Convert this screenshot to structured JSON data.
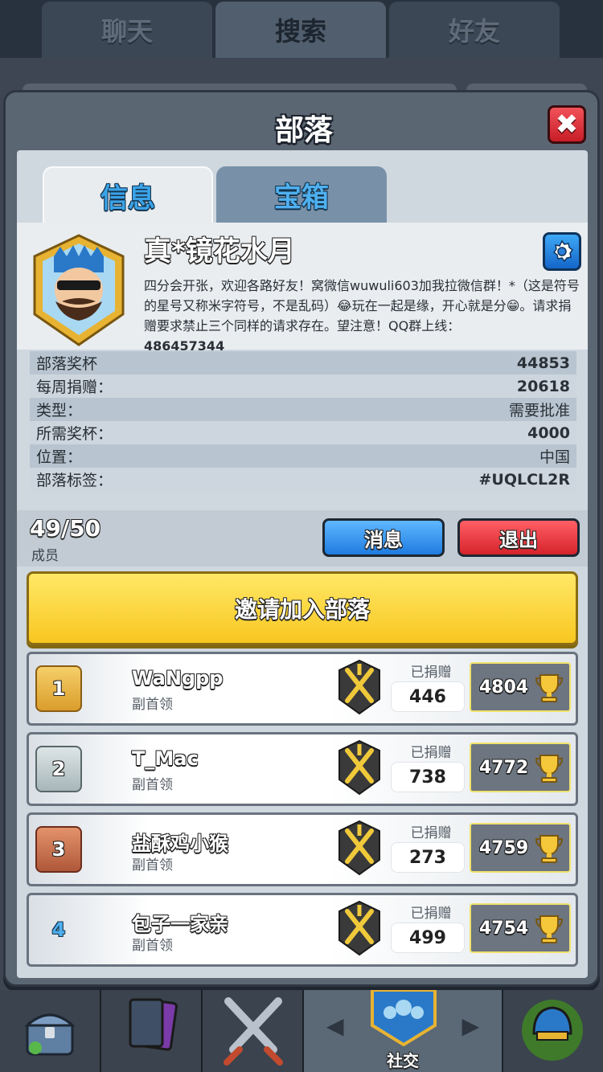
{
  "top_tabs": [
    {
      "label": "聊天",
      "active": false
    },
    {
      "label": "搜索",
      "active": true
    },
    {
      "label": "好友",
      "active": false
    }
  ],
  "panel": {
    "title": "部落",
    "close_label": "✖"
  },
  "inner_tabs": [
    {
      "label": "信息",
      "active": true
    },
    {
      "label": "宝箱",
      "active": false
    }
  ],
  "clan": {
    "name": "真*镜花水月",
    "description": "四分会开张，欢迎各路好友！窝微信wuwuli603加我拉微信群！*（这是符号的星号又称米字符号，不是乱码）😂玩在一起是缘，开心就是分😁。请求捐赠要求禁止三个同样的请求存在。望注意！QQ群上线：",
    "description_id": "486457344",
    "badge_icon": "king-shield-badge-icon",
    "stats": [
      {
        "label": "部落奖杯",
        "value": "44853"
      },
      {
        "label": "每周捐赠：",
        "value": "20618"
      },
      {
        "label": "类型：",
        "value": "需要批准"
      },
      {
        "label": "所需奖杯：",
        "value": "4000"
      },
      {
        "label": "位置：",
        "value": "中国"
      },
      {
        "label": "部落标签：",
        "value": "#UQLCL2R"
      }
    ]
  },
  "members": {
    "count": "49/50",
    "label": "成员",
    "message_button": "消息",
    "leave_button": "退出",
    "invite_button": "邀请加入部落",
    "donated_label": "已捐赠",
    "list": [
      {
        "rank": "1",
        "name": "WaNgpp",
        "role": "副首领",
        "donated": "446",
        "trophies": "4804",
        "rank_style": "gold"
      },
      {
        "rank": "2",
        "name": "T_Mac",
        "role": "副首领",
        "donated": "738",
        "trophies": "4772",
        "rank_style": "silver"
      },
      {
        "rank": "3",
        "name": "盐酥鸡小猴",
        "role": "副首领",
        "donated": "273",
        "trophies": "4759",
        "rank_style": "bronze"
      },
      {
        "rank": "4",
        "name": "包子一家亲",
        "role": "副首领",
        "donated": "499",
        "trophies": "4754",
        "rank_style": "plain"
      }
    ]
  },
  "bottom_nav": {
    "social_label": "社交",
    "items": [
      "chest-icon",
      "cards-icon",
      "crossed-swords-icon",
      "social-icon",
      "tournament-helmet-icon"
    ]
  },
  "colors": {
    "accent_blue": "#3ba3e8",
    "invite_yellow": "#f8c720",
    "leave_red": "#d6232b",
    "trophy_gold": "#f0c93a"
  }
}
